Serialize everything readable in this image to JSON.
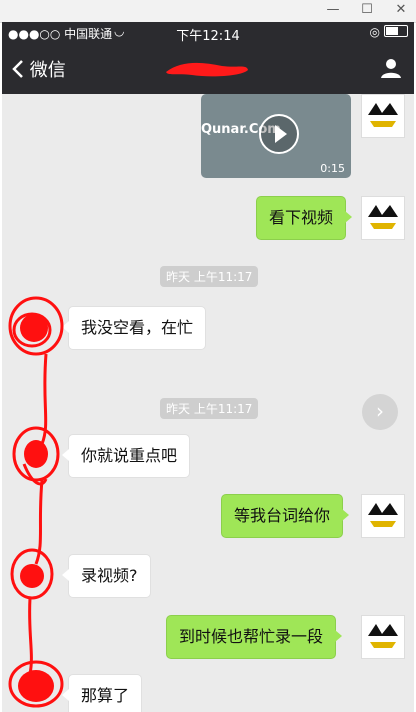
{
  "window": {
    "minimize": "—",
    "maximize": "☐",
    "close": "✕"
  },
  "status": {
    "carrier": "●●●○○ 中国联通",
    "time": "下午12:14"
  },
  "nav": {
    "back_label": "微信",
    "back_icon": "chevron-left",
    "profile_icon": "person-icon"
  },
  "video": {
    "logo_text": "Qunar.Com",
    "duration": "0:15"
  },
  "messages": [
    {
      "from": "me",
      "text": "看下视频"
    },
    {
      "timestamp": "昨天 上午11:17"
    },
    {
      "from": "other",
      "text": "我没空看，在忙"
    },
    {
      "timestamp": "昨天 上午11:17"
    },
    {
      "from": "other",
      "text": "你就说重点吧"
    },
    {
      "from": "me",
      "text": "等我台词给你"
    },
    {
      "from": "other",
      "text": "录视频?"
    },
    {
      "from": "me",
      "text": "到时候也帮忙录一段"
    },
    {
      "from": "other",
      "text": "那算了"
    }
  ],
  "colors": {
    "bar": "#2b2b2f",
    "chat_bg": "#ebebeb",
    "me_bubble": "#9fe657",
    "other_bubble": "#ffffff",
    "scribble": "#ff0000"
  }
}
